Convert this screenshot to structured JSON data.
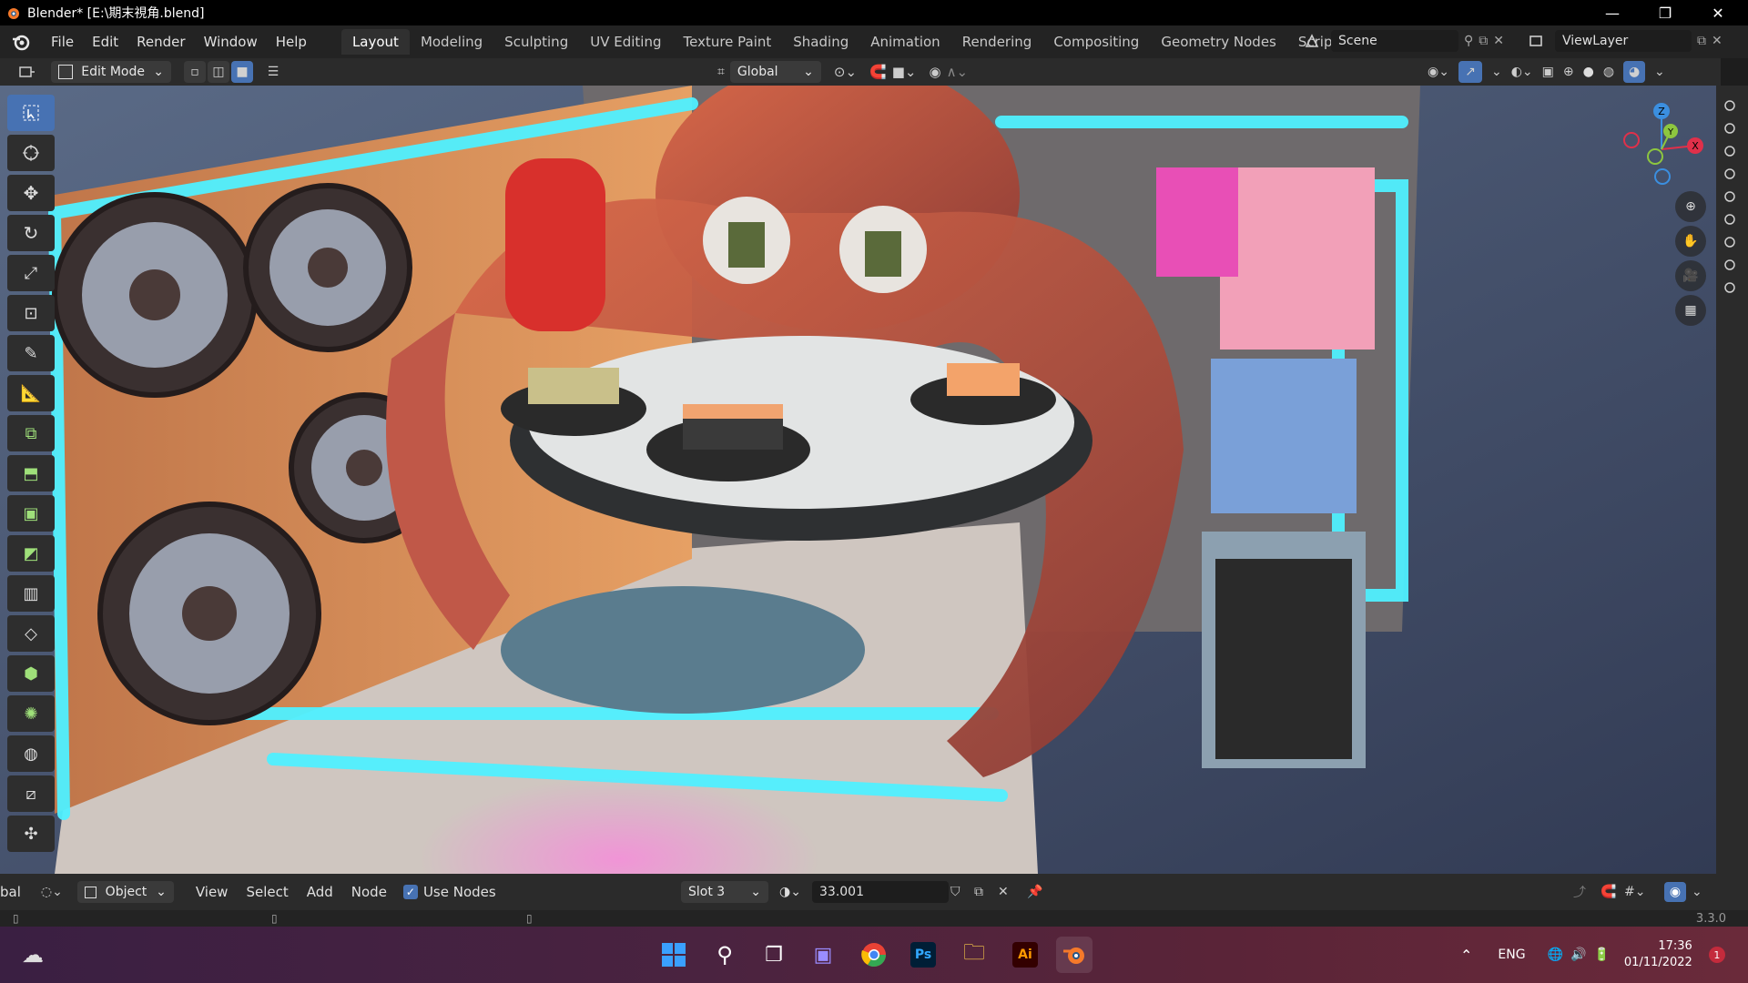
{
  "window": {
    "title": "Blender* [E:\\期末視角.blend]",
    "controls": {
      "minimize": "—",
      "restore": "❐",
      "close": "✕"
    }
  },
  "menu": {
    "items": [
      "File",
      "Edit",
      "Render",
      "Window",
      "Help"
    ]
  },
  "workspaces": {
    "tabs": [
      "Layout",
      "Modeling",
      "Sculpting",
      "UV Editing",
      "Texture Paint",
      "Shading",
      "Animation",
      "Rendering",
      "Compositing",
      "Geometry Nodes",
      "Scripting"
    ],
    "active": "Layout",
    "add_label": "+"
  },
  "scene": {
    "name": "Scene",
    "view_layer": "ViewLayer"
  },
  "viewport_header": {
    "mode": "Edit Mode",
    "transform_orientation": "Global"
  },
  "node_editor_header": {
    "left_cut": "bal",
    "object_type": "Object",
    "menus": [
      "View",
      "Select",
      "Add",
      "Node"
    ],
    "use_nodes_label": "Use Nodes",
    "use_nodes_checked": true,
    "slot": "Slot 3",
    "material_name": "33.001"
  },
  "status": {
    "version": "3.3.0"
  },
  "taskbar": {
    "lang": "ENG",
    "time": "17:36",
    "date": "01/11/2022",
    "notification_count": "1"
  },
  "colors": {
    "accent": "#4772b3",
    "neon_cyan": "#4ff0ff",
    "neon_pink": "#ff5fd0",
    "octopus": "#c8553d"
  }
}
